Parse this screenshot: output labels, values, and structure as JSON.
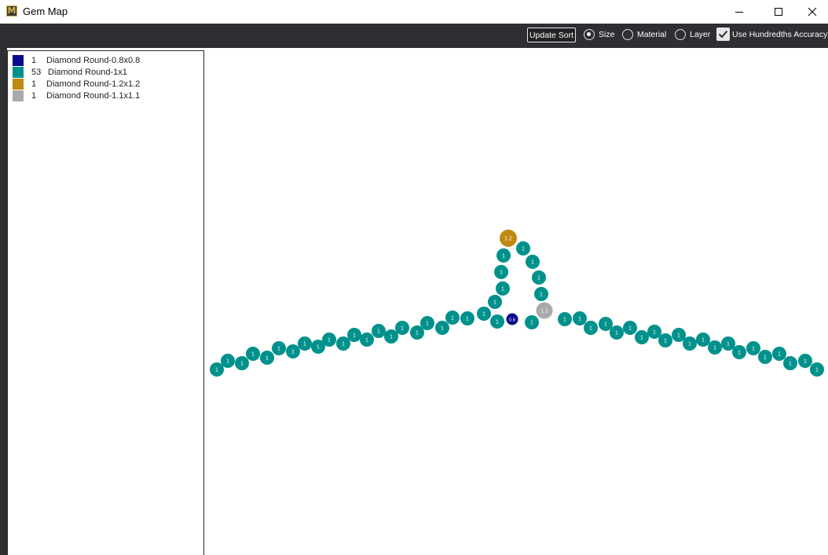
{
  "window": {
    "title": "Gem Map",
    "icon": "M",
    "controls": [
      "minimize-icon",
      "maximize-icon",
      "close-icon"
    ]
  },
  "toolbar": {
    "update_sort_label": "Update Sort",
    "sort_options": [
      {
        "label": "Size",
        "selected": true
      },
      {
        "label": "Material",
        "selected": false
      },
      {
        "label": "Layer",
        "selected": false
      }
    ],
    "hundredths_label": "Use Hundredths Accuracy",
    "hundredths_checked": true
  },
  "legend": [
    {
      "count": "1",
      "name": "Diamond Round-0.8x0.8",
      "color": "#0a0a8c"
    },
    {
      "count": "53",
      "name": "Diamond Round-1x1",
      "color": "#00918c"
    },
    {
      "count": "1",
      "name": "Diamond Round-1.2x1.2",
      "color": "#c08a12"
    },
    {
      "count": "1",
      "name": "Diamond Round-1.1x1.1",
      "color": "#a9a9a9"
    }
  ],
  "gems": {
    "labels": {
      "0.8": "0.8",
      "1": "1",
      "1.1": "1.1",
      "1.2": "1.2"
    },
    "colors": {
      "0.8": "#0a0a8c",
      "1": "#00918c",
      "1.1": "#a9a9a9",
      "1.2": "#c08a12"
    }
  }
}
